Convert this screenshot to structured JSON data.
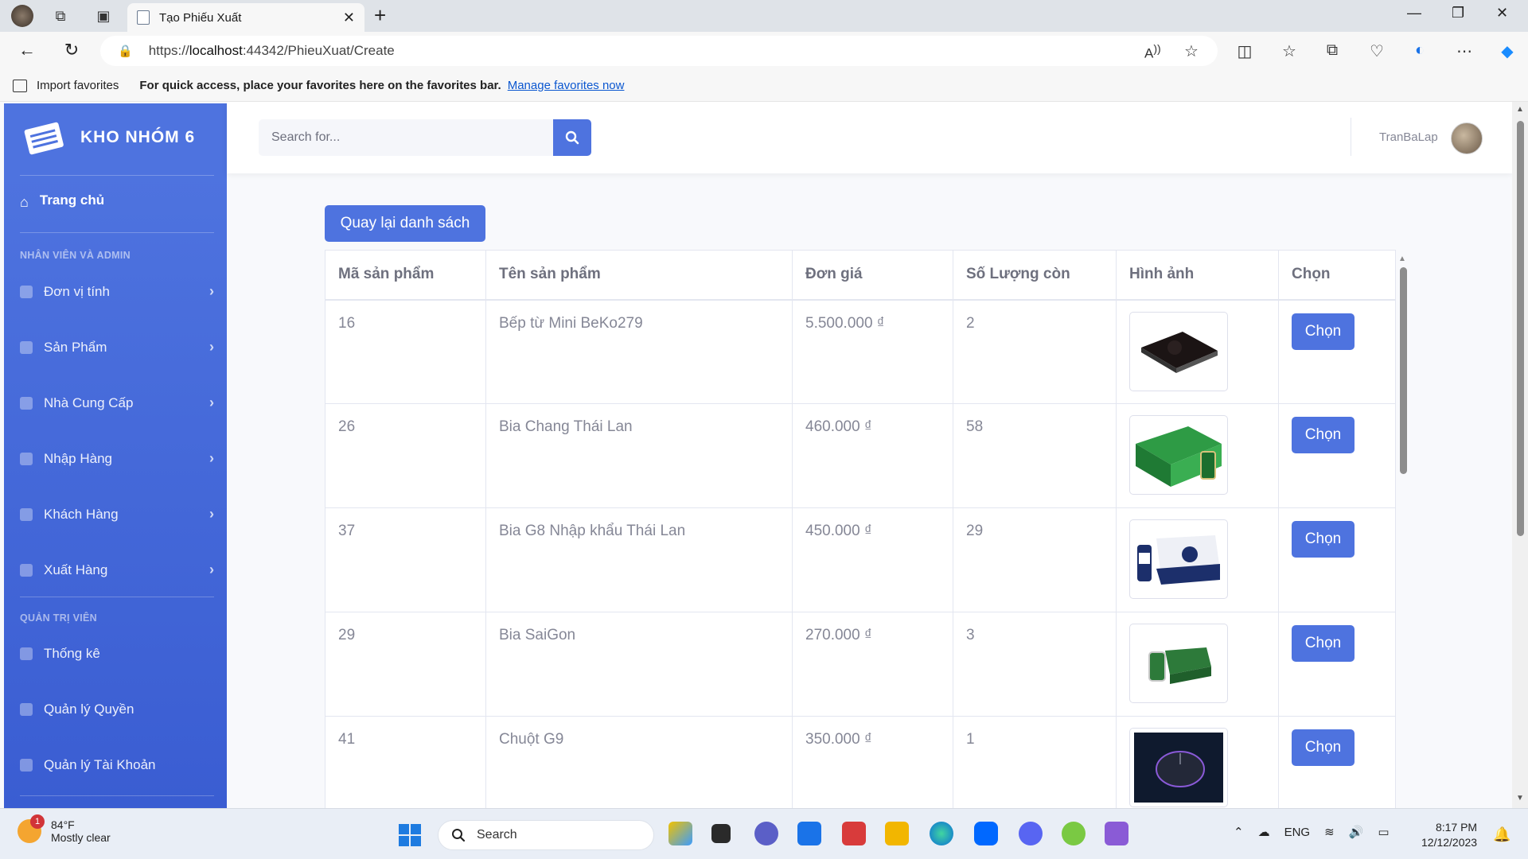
{
  "browser": {
    "tab_title": "Tạo Phiếu Xuất",
    "url_prefix": "https://",
    "url_host": "localhost",
    "url_rest": ":44342/PhieuXuat/Create"
  },
  "favorites_bar": {
    "import_label": "Import favorites",
    "message": "For quick access, place your favorites here on the favorites bar.",
    "manage_link": "Manage favorites now"
  },
  "sidebar": {
    "brand": "KHO NHÓM 6",
    "home": "Trang chủ",
    "section1": "NHÂN VIÊN VÀ ADMIN",
    "items1": [
      "Đơn vị tính",
      "Sản Phẩm",
      "Nhà Cung Cấp",
      "Nhập Hàng",
      "Khách Hàng",
      "Xuất Hàng"
    ],
    "section2": "QUẢN TRỊ VIÊN",
    "items2": [
      "Thống kê",
      "Quản lý Quyền",
      "Quản lý Tài Khoản"
    ]
  },
  "topbar": {
    "search_placeholder": "Search for...",
    "username": "TranBaLap"
  },
  "back_button": "Quay lại danh sách",
  "table": {
    "headers": [
      "Mã sản phẩm",
      "Tên sản phẩm",
      "Đơn giá",
      "Số Lượng còn",
      "Hình ảnh",
      "Chọn"
    ],
    "rows": [
      {
        "id": "16",
        "name": "Bếp từ Mini BeKo279",
        "price": "5.500.000 ₫",
        "qty": "2",
        "action": "Chọn"
      },
      {
        "id": "26",
        "name": "Bia Chang Thái Lan",
        "price": "460.000 ₫",
        "qty": "58",
        "action": "Chọn"
      },
      {
        "id": "37",
        "name": "Bia G8 Nhập khẩu Thái Lan",
        "price": "450.000 ₫",
        "qty": "29",
        "action": "Chọn"
      },
      {
        "id": "29",
        "name": "Bia SaiGon",
        "price": "270.000 ₫",
        "qty": "3",
        "action": "Chọn"
      },
      {
        "id": "41",
        "name": "Chuột G9",
        "price": "350.000 ₫",
        "qty": "1",
        "action": "Chọn"
      }
    ]
  },
  "taskbar": {
    "weather_badge": "1",
    "temp": "84°F",
    "condition": "Mostly clear",
    "search": "Search",
    "lang": "ENG",
    "time": "8:17 PM",
    "date": "12/12/2023"
  },
  "colors": {
    "primary": "#4e73df",
    "sidebar_bottom": "#3a5dd2"
  }
}
